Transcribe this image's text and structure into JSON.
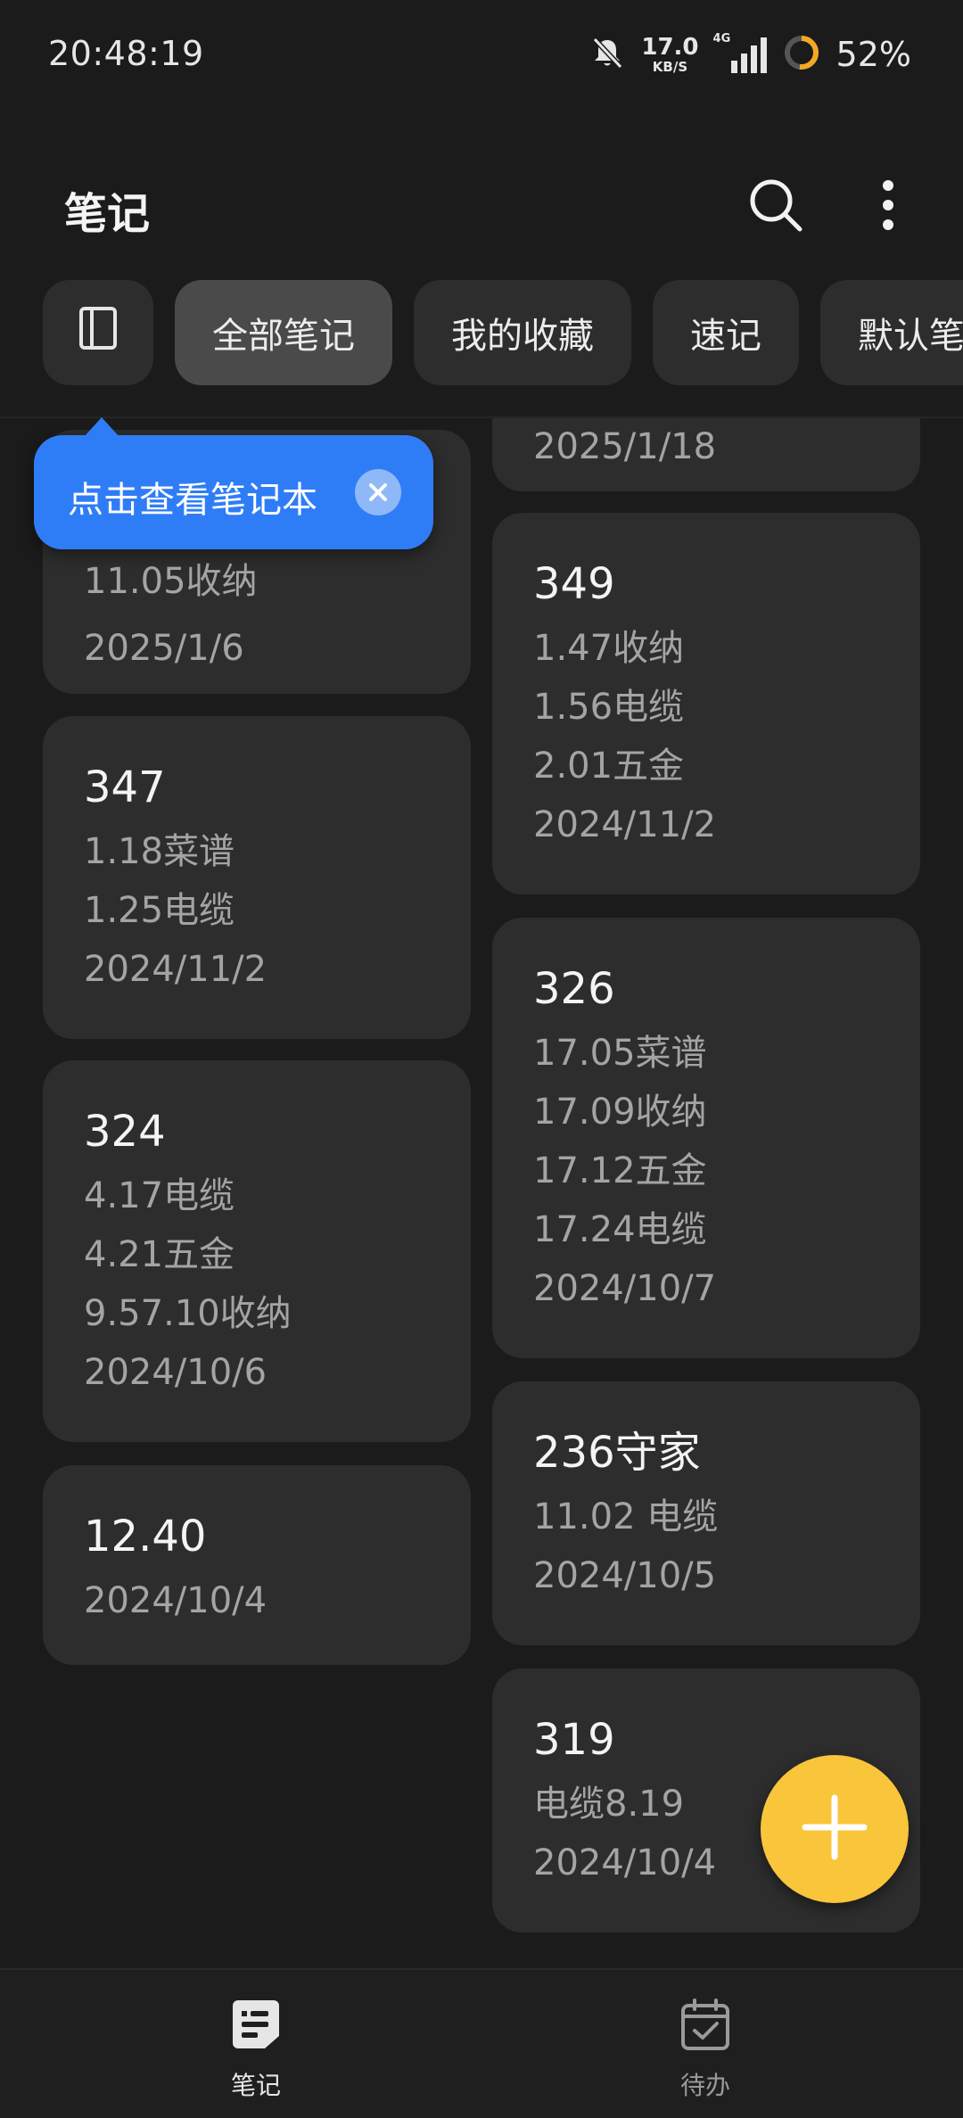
{
  "status_bar": {
    "time": "20:48:19",
    "net_speed_value": "17.0",
    "net_speed_unit": "KB/S",
    "network_type": "4G",
    "battery": "52%",
    "icons": [
      "mute-bell-icon",
      "signal-icon",
      "battery-ring-icon"
    ]
  },
  "header": {
    "title": "笔记",
    "icons": [
      "search-icon",
      "more-vertical-icon"
    ]
  },
  "chips": {
    "notebook_icon": "notebook-icon",
    "items": [
      "全部笔记",
      "我的收藏",
      "速记",
      "默认笔记本"
    ],
    "active_index": 0
  },
  "tooltip": {
    "text": "点击查看笔记本",
    "close_icon": "close-icon"
  },
  "notes": {
    "left": [
      {
        "lines": [
          "11.05收纳"
        ],
        "date": "2025/1/6"
      },
      {
        "title": "347",
        "lines": [
          "1.18菜谱",
          "1.25电缆"
        ],
        "date": "2024/11/2"
      },
      {
        "title": "324",
        "lines": [
          "4.17电缆",
          "4.21五金",
          "9.57.10收纳"
        ],
        "date": "2024/10/6"
      },
      {
        "title": "12.40",
        "lines": [],
        "date": "2024/10/4"
      }
    ],
    "right": [
      {
        "date": "2025/1/18"
      },
      {
        "title": "349",
        "lines": [
          "1.47收纳",
          "1.56电缆",
          "2.01五金"
        ],
        "date": "2024/11/2"
      },
      {
        "title": "326",
        "lines": [
          "17.05菜谱",
          "17.09收纳",
          "17.12五金",
          "17.24电缆"
        ],
        "date": "2024/10/7"
      },
      {
        "title": "236守家",
        "lines": [
          "11.02 电缆"
        ],
        "date": "2024/10/5"
      },
      {
        "title": "319",
        "lines": [
          "电缆8.19"
        ],
        "date": "2024/10/4"
      }
    ]
  },
  "fab": {
    "icon": "plus-icon",
    "color": "#f9c53a"
  },
  "bottom_nav": {
    "items": [
      {
        "label": "笔记",
        "icon": "notes-icon",
        "active": true
      },
      {
        "label": "待办",
        "icon": "todo-icon",
        "active": false
      }
    ]
  },
  "colors": {
    "background": "#1b1b1b",
    "card": "#2d2d2d",
    "accent_blue": "#2f7df6",
    "accent_yellow": "#f9c53a"
  }
}
